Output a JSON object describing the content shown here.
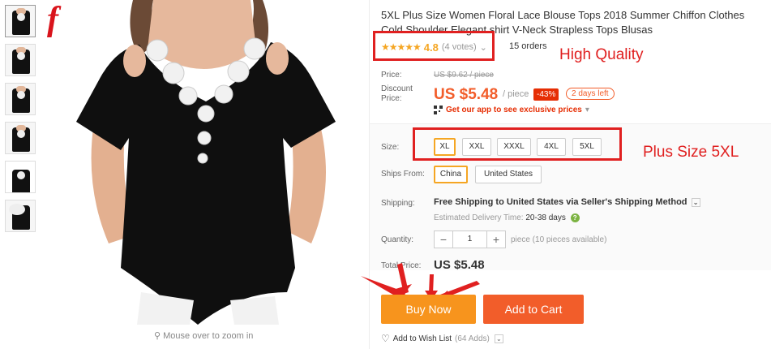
{
  "brand": {
    "logo_letter": "f"
  },
  "gallery": {
    "thumbnails": [
      "thumb-1",
      "thumb-2",
      "thumb-3",
      "thumb-4",
      "thumb-5",
      "thumb-6"
    ],
    "zoom_hint": "Mouse over to zoom in"
  },
  "product": {
    "title": "5XL Plus Size Women Floral Lace Blouse Tops 2018 Summer Chiffon Clothes Cold Shoulder Elegant shirt V-Neck Strapless Tops Blusas",
    "rating_value": "4.8",
    "votes": "(4 votes)",
    "orders": "15 orders"
  },
  "annotations": {
    "high_quality": "High Quality",
    "plus_size": "Plus Size 5XL"
  },
  "price": {
    "label": "Price:",
    "old_price": "US $9.62 / piece",
    "discount_label": "Discount\nPrice:",
    "discount_price": "US $5.48",
    "per_piece": "/ piece",
    "discount_pct": "-43%",
    "days_left": "2 days left",
    "app_promo": "Get our app to see exclusive prices"
  },
  "size": {
    "label": "Size:",
    "options": [
      "XL",
      "XXL",
      "XXXL",
      "4XL",
      "5XL"
    ],
    "selected": "XL"
  },
  "ships_from": {
    "label": "Ships From:",
    "options": [
      "China",
      "United States"
    ],
    "selected": "China"
  },
  "shipping": {
    "label": "Shipping:",
    "free": "Free Shipping",
    "to": "to",
    "country": "United States",
    "via": "via Seller's Shipping Method",
    "est_label": "Estimated Delivery Time:",
    "est_value": "20-38 days"
  },
  "quantity": {
    "label": "Quantity:",
    "minus": "−",
    "value": "1",
    "plus": "+",
    "note": "piece (10 pieces available)"
  },
  "total": {
    "label": "Total Price:",
    "value": "US $5.48"
  },
  "actions": {
    "buy_now": "Buy Now",
    "add_to_cart": "Add to Cart",
    "wish_label": "Add to Wish List",
    "wish_count": "(64 Adds)"
  },
  "colors": {
    "accent_orange": "#f7941d",
    "price_orange": "#f25d2a",
    "annotation_red": "#e02020",
    "star": "#f5a623"
  }
}
